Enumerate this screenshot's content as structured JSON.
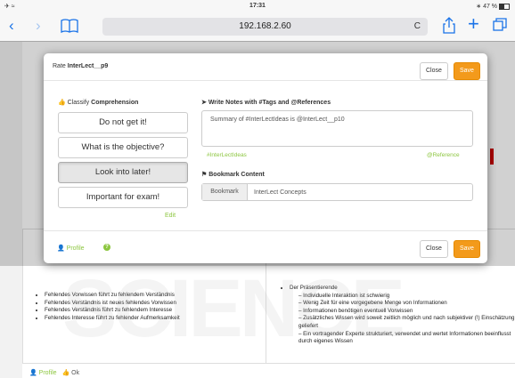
{
  "status_bar": {
    "time": "17:31",
    "battery": "47 %"
  },
  "browser": {
    "url": "192.168.2.60",
    "reload_icon": "C"
  },
  "modal": {
    "title_prefix": "Rate",
    "title_name": "InterLect__p9",
    "header_close": "Close",
    "header_save": "Save",
    "classify": {
      "heading_prefix": "Classify",
      "heading_bold": "Comprehension",
      "options": [
        "Do not get it!",
        "What is the objective?",
        "Look into later!",
        "Important for exam!"
      ],
      "selected_index": 2,
      "edit": "Edit"
    },
    "notes": {
      "heading": "Write Notes with #Tags and @References",
      "text": "Summary of #InterLectIdeas is @InterLect__p10",
      "tag": "#InterLectIdeas",
      "reference": "@Reference"
    },
    "bookmark": {
      "heading": "Bookmark Content",
      "addon": "Bookmark",
      "value": "InterLect Concepts"
    },
    "footer": {
      "profile": "Profile",
      "close": "Close",
      "save": "Save"
    }
  },
  "slides": {
    "left_bullets": [
      "Fehlendes Vorwissen führt zu fehlendem Verständnis",
      "Fehlendes Verständnis ist neues fehlendes Vorwissen",
      "Fehlendes Verständnis führt zu fehlendem Interesse",
      "Fehlendes Interesse führt zu fehlender Aufmerksamkeit"
    ],
    "right_heading": "Der Präsentierende",
    "right_sub": [
      "Individuelle Interaktion ist schwierig",
      "Wenig Zeit für eine vorgegebene Menge von Informationen",
      "Informationen benötigen eventuell Vorwissen",
      "Zusätzliches Wissen wird soweit zeitlich möglich und nach subjektiver (!) Einschätzung geliefert",
      "Ein vortragender Experte strukturiert, verwendet und wertet Informationen beeinflusst durch eigenes Wissen"
    ],
    "bottom_profile": "Profile",
    "bottom_ok": "Ok"
  },
  "colors": {
    "accent_green": "#8cc63f",
    "save_orange": "#f39a1b",
    "ios_blue": "#1a73e8"
  }
}
